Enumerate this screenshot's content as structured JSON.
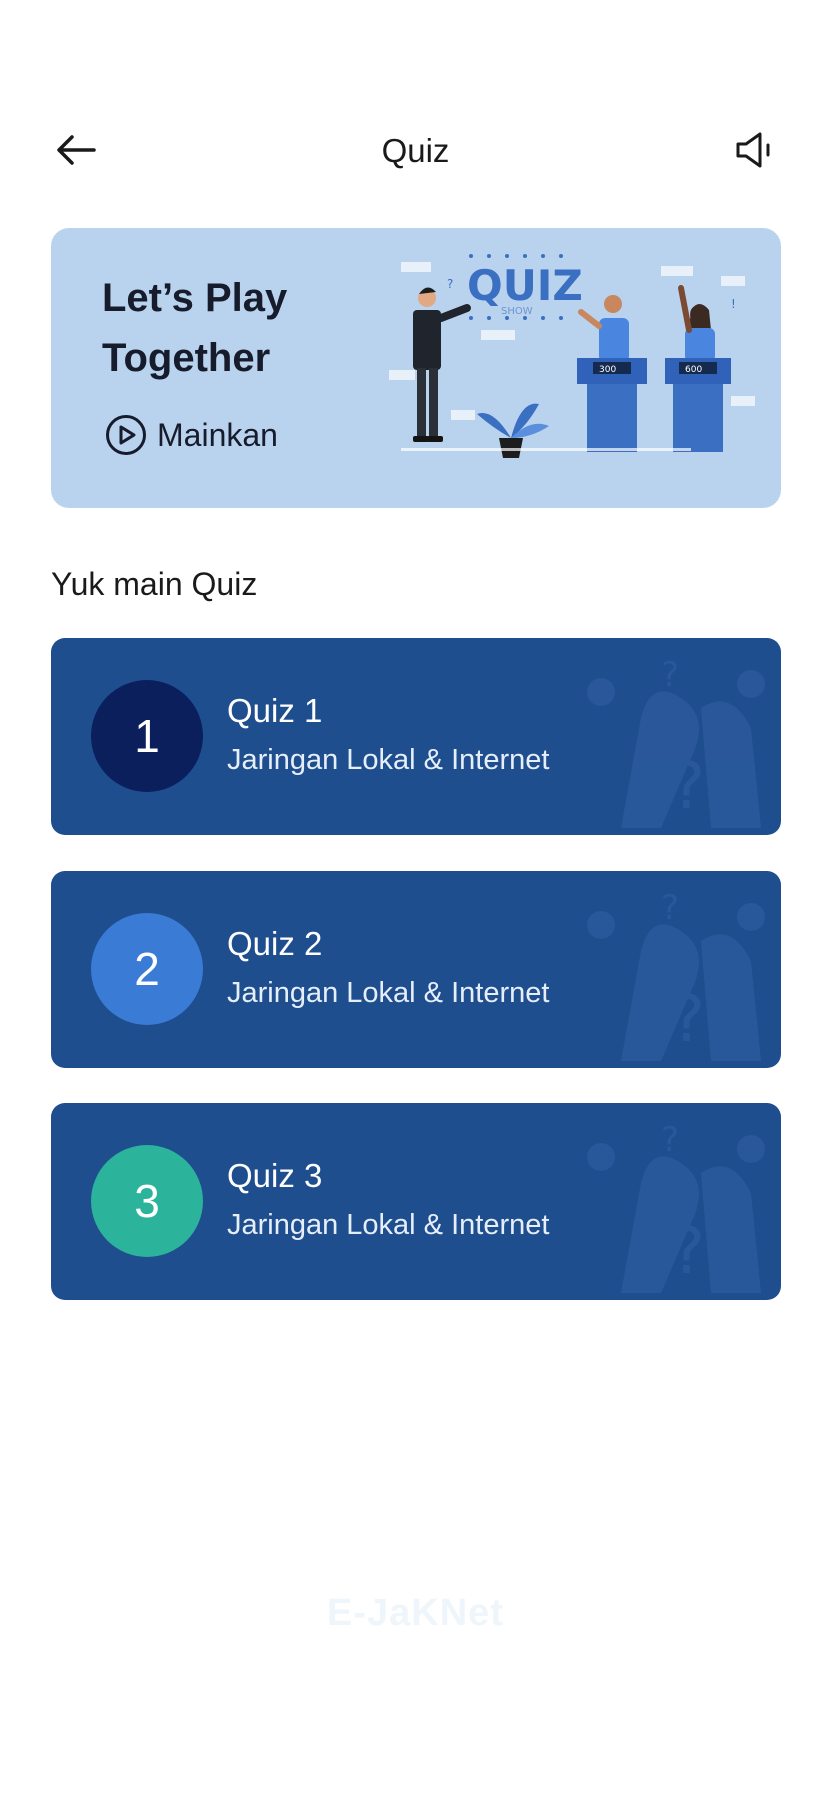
{
  "header": {
    "title": "Quiz",
    "back_icon": "arrow-left-icon",
    "sound_icon": "speaker-icon"
  },
  "banner": {
    "title": "Let’s Play Together",
    "play_label": "Mainkan",
    "illustration_text": "QUIZ",
    "illustration_subtext": "SHOW",
    "podium_scores": [
      "300",
      "600"
    ],
    "background": "#b9d3ee"
  },
  "section": {
    "title": "Yuk main Quiz"
  },
  "quizzes": [
    {
      "number": "1",
      "name": "Quiz 1",
      "subtitle": "Jaringan Lokal & Internet",
      "badge_color": "#0a1f5c"
    },
    {
      "number": "2",
      "name": "Quiz 2",
      "subtitle": "Jaringan Lokal & Internet",
      "badge_color": "#3a7bd5"
    },
    {
      "number": "3",
      "name": "Quiz 3",
      "subtitle": "Jaringan Lokal & Internet",
      "badge_color": "#2bb39b"
    }
  ],
  "colors": {
    "card": "#1f4e8f"
  },
  "footer": {
    "brand": "E-JaKNet"
  }
}
